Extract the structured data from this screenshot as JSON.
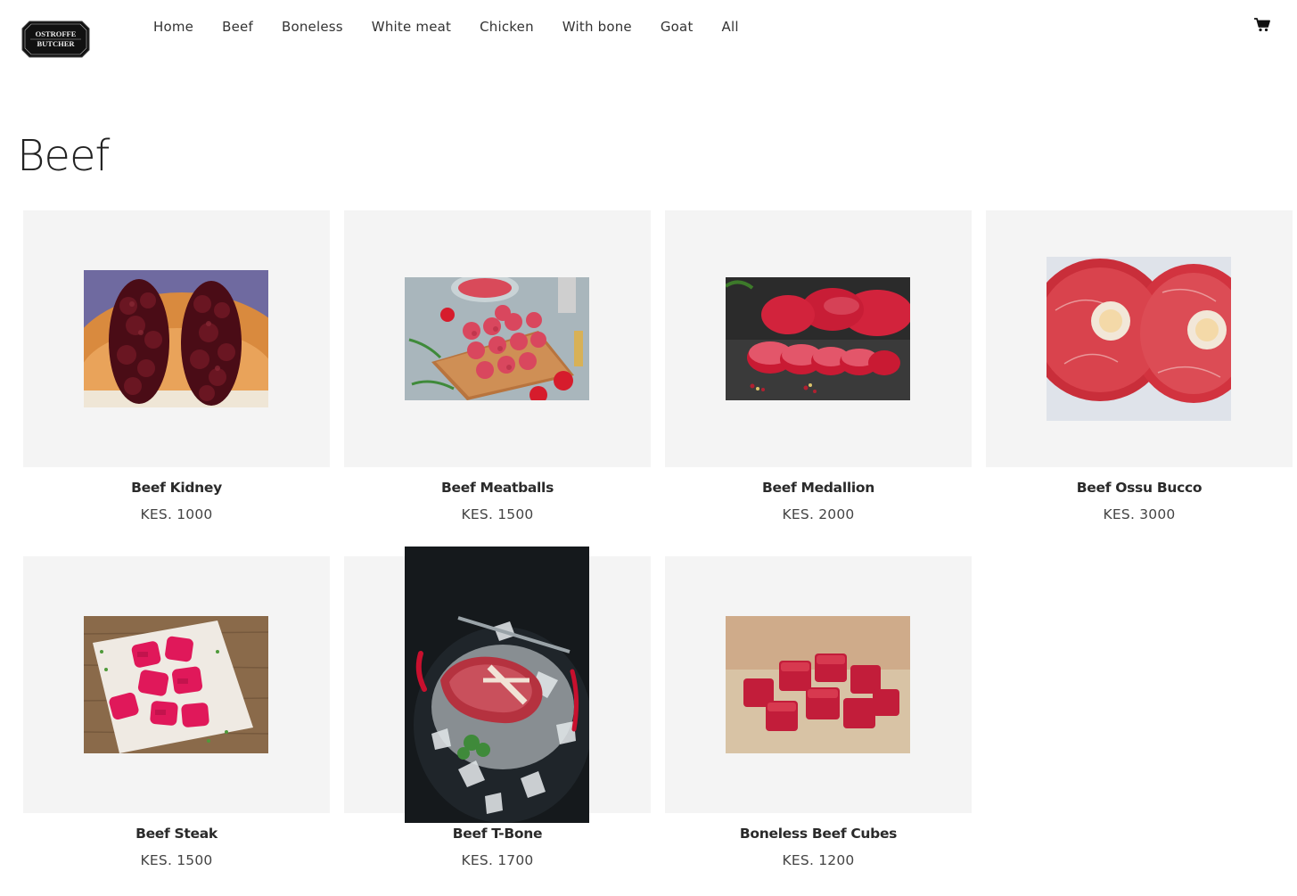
{
  "brand": {
    "line1": "OSTROFFE",
    "line2": "BUTCHER"
  },
  "nav": {
    "items": [
      {
        "label": "Home"
      },
      {
        "label": "Beef"
      },
      {
        "label": "Boneless"
      },
      {
        "label": "White meat"
      },
      {
        "label": "Chicken"
      },
      {
        "label": "With bone"
      },
      {
        "label": "Goat"
      },
      {
        "label": "All"
      }
    ],
    "cart_icon": "shopping-cart-icon"
  },
  "page": {
    "title": "Beef"
  },
  "products": [
    {
      "name": "Beef Kidney",
      "price": "KES. 1000"
    },
    {
      "name": "Beef Meatballs",
      "price": "KES. 1500"
    },
    {
      "name": "Beef Medallion",
      "price": "KES. 2000"
    },
    {
      "name": "Beef Ossu Bucco",
      "price": "KES. 3000"
    },
    {
      "name": "Beef Steak",
      "price": "KES. 1500"
    },
    {
      "name": "Beef T-Bone",
      "price": "KES. 1700"
    },
    {
      "name": "Boneless Beef Cubes",
      "price": "KES. 1200"
    }
  ],
  "colors": {
    "tile_bg": "#f4f4f4",
    "meat_red": "#c8283a",
    "text_dark": "#2a2a2a"
  }
}
